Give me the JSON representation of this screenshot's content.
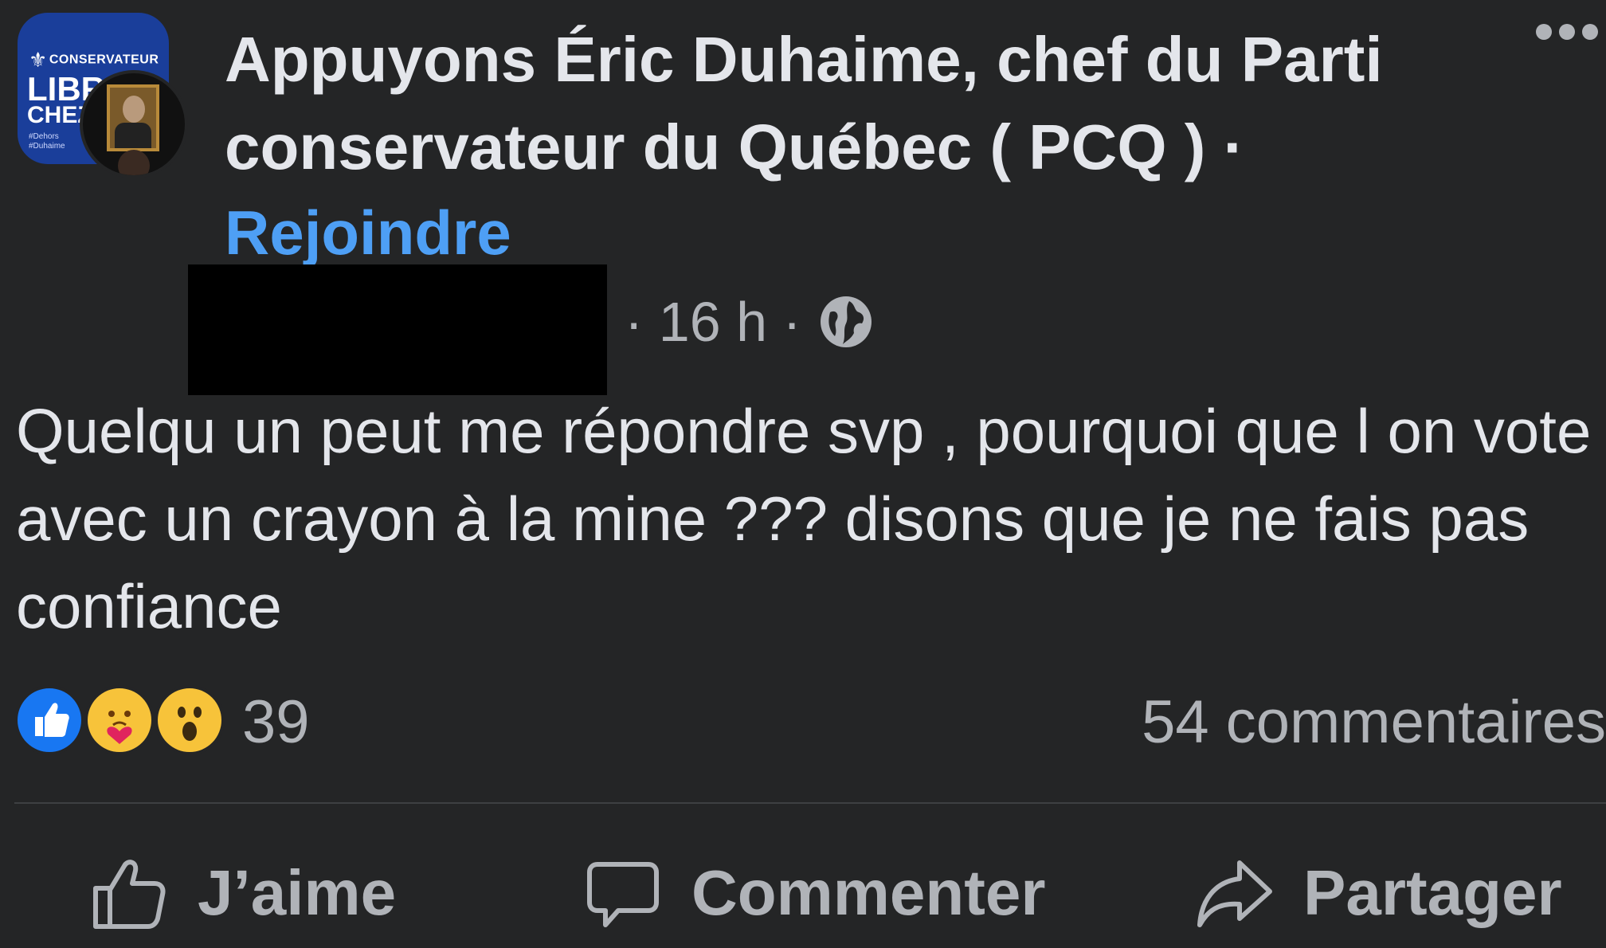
{
  "group_avatar": {
    "line1": "CONSERVATEUR",
    "line2": "LIBRES",
    "line3": "CHEZ",
    "tags": [
      "#Dehors",
      "#Duhaime"
    ]
  },
  "post": {
    "group_title": "Appuyons Éric Duhaime, chef du Parti conservateur du Québec ( PCQ ) ·",
    "join_label": "Rejoindre",
    "time": "· 16 h ·",
    "text": "Quelqu un peut me répondre svp , pourquoi que l on vote avec un crayon à la mine ??? disons que je ne fais pas confiance",
    "reaction_count": "39",
    "comments_count": "54 commentaires"
  },
  "actions": {
    "like_label": "J’aime",
    "comment_label": "Commenter",
    "share_label": "Partager"
  },
  "icons": {
    "more": "more-horizontal-icon",
    "privacy": "globe-icon",
    "reactions": [
      "like-reaction-icon",
      "care-reaction-icon",
      "wow-reaction-icon"
    ],
    "like": "thumbs-up-icon",
    "comment": "comment-bubble-icon",
    "share": "share-arrow-icon"
  },
  "colors": {
    "background": "#242526",
    "text_primary": "#e4e6eb",
    "text_secondary": "#b0b3b8",
    "link": "#4e9ff5",
    "like_blue": "#1877f2"
  }
}
